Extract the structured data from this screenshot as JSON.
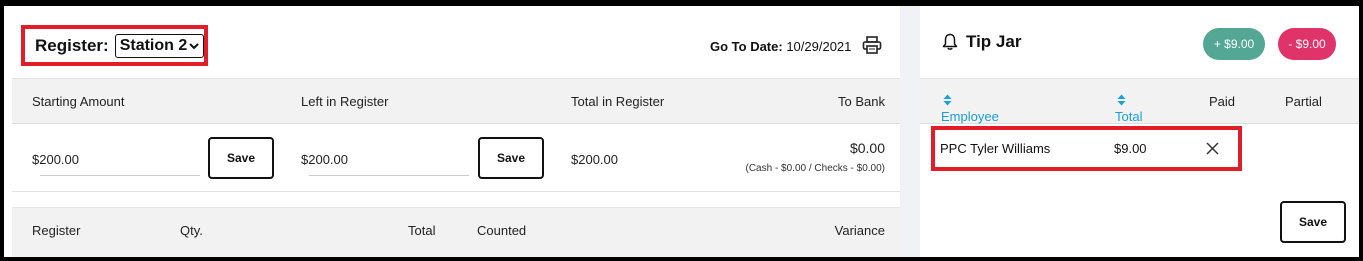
{
  "register": {
    "label": "Register:",
    "selected_station": "Station 2",
    "goto_label": "Go To Date:",
    "goto_date": "10/29/2021"
  },
  "summary_headers": [
    "Starting Amount",
    "Left in Register",
    "Total in Register",
    "To Bank"
  ],
  "summary_row": {
    "starting_amount": "$200.00",
    "left_in_register": "$200.00",
    "total_in_register": "$200.00",
    "to_bank": "$0.00",
    "to_bank_detail": "(Cash - $0.00 / Checks - $0.00)",
    "save_label": "Save"
  },
  "detail_headers": [
    "Register",
    "Qty.",
    "Total",
    "Counted",
    "Variance"
  ],
  "tip_jar": {
    "title": "Tip Jar",
    "add_label": "+ $9.00",
    "subtract_label": "- $9.00",
    "headers": {
      "employee": "Employee",
      "total": "Total",
      "paid": "Paid",
      "partial": "Partial"
    },
    "rows": [
      {
        "employee": "PPC Tyler Williams",
        "total": "$9.00"
      }
    ],
    "save_label": "Save"
  },
  "colors": {
    "highlight": "#e11d2a",
    "link_blue": "#1a9fd9",
    "add_green": "#55a795",
    "subtract_pink": "#e0336a"
  },
  "icons": [
    "chevron-down-icon",
    "printer-icon",
    "bell-icon",
    "sort-icon",
    "close-icon"
  ]
}
